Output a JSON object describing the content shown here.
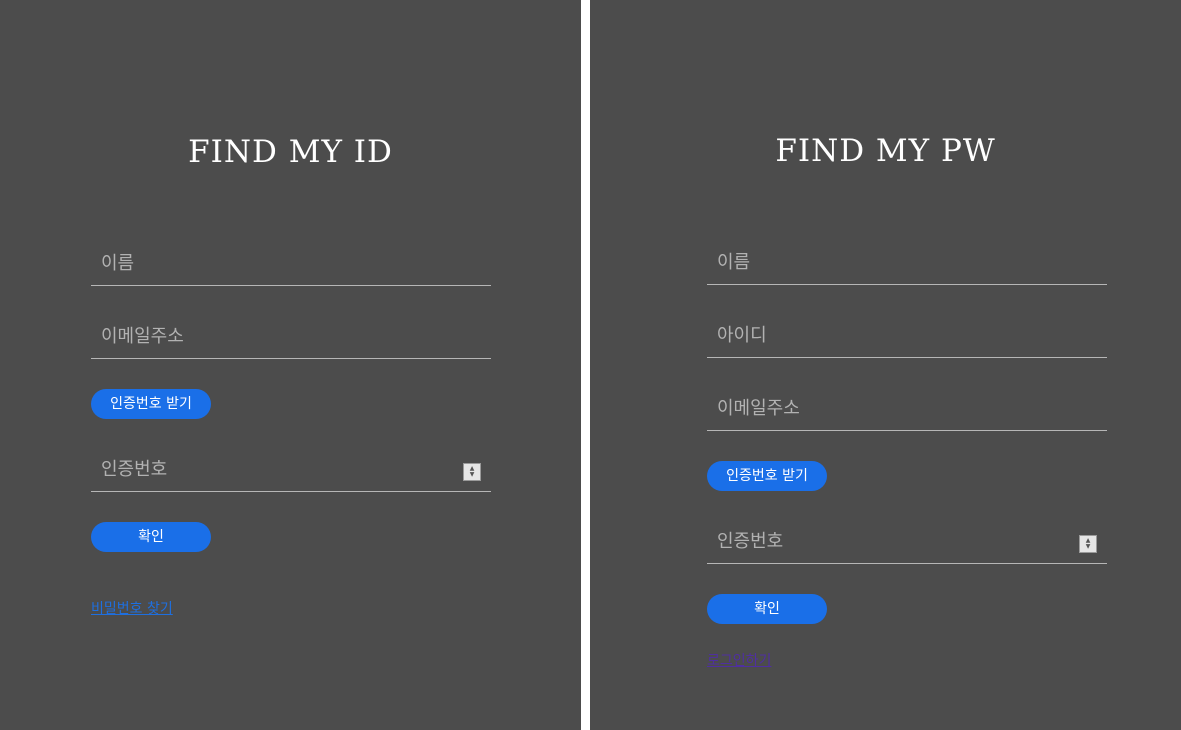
{
  "find_id": {
    "title": "FIND MY ID",
    "name_placeholder": "이름",
    "email_placeholder": "이메일주소",
    "send_code_label": "인증번호 받기",
    "code_placeholder": "인증번호",
    "confirm_label": "확인",
    "link_label": "비밀번호 찾기"
  },
  "find_pw": {
    "title": "FIND MY PW",
    "name_placeholder": "이름",
    "id_placeholder": "아이디",
    "email_placeholder": "이메일주소",
    "send_code_label": "인증번호 받기",
    "code_placeholder": "인증번호",
    "confirm_label": "확인",
    "link_label": "로그인하기"
  },
  "colors": {
    "panel_background": "#4c4c4c",
    "button_blue": "#1a6fe8",
    "link_blue": "#1e6fe0",
    "link_visited": "#4f2fa0"
  }
}
